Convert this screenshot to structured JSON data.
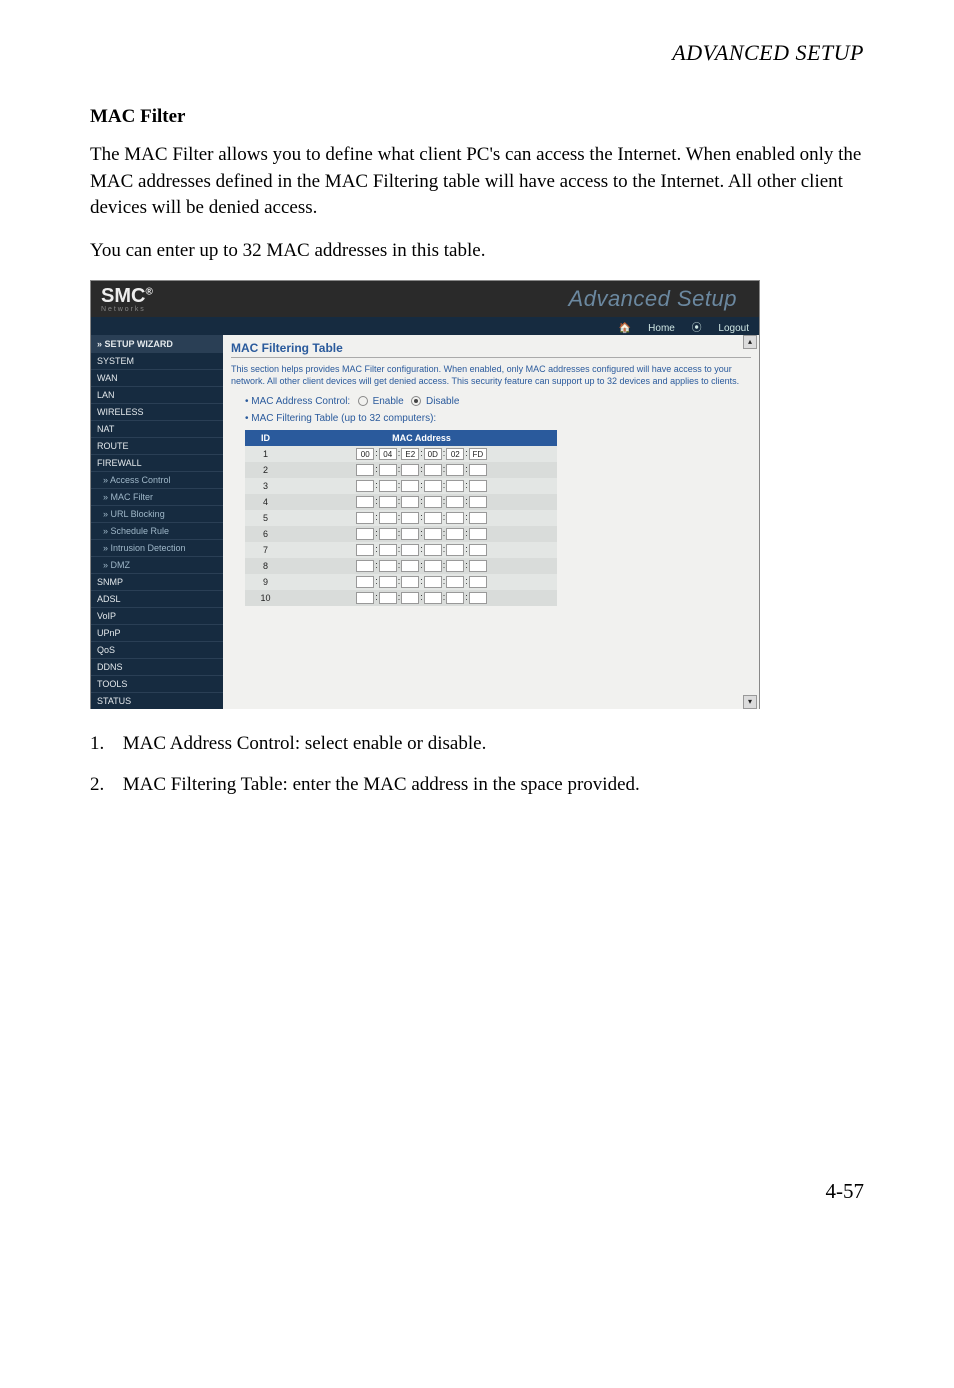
{
  "page_header": "ADVANCED SETUP",
  "h3": "MAC Filter",
  "para1": "The MAC Filter allows you to define what client PC's can access the Internet. When enabled only the MAC addresses defined in the MAC Filtering table will have access to the Internet. All other client devices will be denied access.",
  "para2": "You can enter up to 32 MAC addresses in this table.",
  "list": {
    "item1": {
      "num": "1.",
      "text": "MAC Address Control: select enable or disable."
    },
    "item2": {
      "num": "2.",
      "text": "MAC Filtering Table: enter the MAC address in the space provided."
    }
  },
  "page_number": "4-57",
  "shot": {
    "brand": "SMC",
    "brand_sub": "N e t w o r k s",
    "brand_reg": "®",
    "banner": "Advanced Setup",
    "topbar_home": "Home",
    "topbar_logout": "Logout",
    "sidebar": {
      "setup": "» SETUP WIZARD",
      "system": "SYSTEM",
      "wan": "WAN",
      "lan": "LAN",
      "wireless": "WIRELESS",
      "nat": "NAT",
      "route": "ROUTE",
      "firewall": "FIREWALL",
      "access_control": "» Access Control",
      "mac_filter": "» MAC Filter",
      "url_blocking": "» URL Blocking",
      "schedule_rule": "» Schedule Rule",
      "intrusion": "» Intrusion Detection",
      "dmz": "» DMZ",
      "snmp": "SNMP",
      "adsl": "ADSL",
      "voip": "VoIP",
      "upnp": "UPnP",
      "qos": "QoS",
      "ddns": "DDNS",
      "tools": "TOOLS",
      "status": "STATUS"
    },
    "panel": {
      "title": "MAC Filtering Table",
      "desc": "This section helps provides MAC Filter configuration. When enabled, only MAC addresses configured will have access to your network. All other client devices will get denied access. This security feature can support up to 32 devices and applies to clients.",
      "addr_control_label": "MAC Address Control:",
      "enable": "Enable",
      "disable": "Disable",
      "table_caption": "MAC Filtering Table (up to 32 computers):",
      "col_id": "ID",
      "col_mac": "MAC Address",
      "rows": [
        {
          "id": "1",
          "mac": [
            "00",
            "04",
            "E2",
            "0D",
            "02",
            "FD"
          ]
        },
        {
          "id": "2",
          "mac": [
            "",
            "",
            "",
            "",
            "",
            ""
          ]
        },
        {
          "id": "3",
          "mac": [
            "",
            "",
            "",
            "",
            "",
            ""
          ]
        },
        {
          "id": "4",
          "mac": [
            "",
            "",
            "",
            "",
            "",
            ""
          ]
        },
        {
          "id": "5",
          "mac": [
            "",
            "",
            "",
            "",
            "",
            ""
          ]
        },
        {
          "id": "6",
          "mac": [
            "",
            "",
            "",
            "",
            "",
            ""
          ]
        },
        {
          "id": "7",
          "mac": [
            "",
            "",
            "",
            "",
            "",
            ""
          ]
        },
        {
          "id": "8",
          "mac": [
            "",
            "",
            "",
            "",
            "",
            ""
          ]
        },
        {
          "id": "9",
          "mac": [
            "",
            "",
            "",
            "",
            "",
            ""
          ]
        },
        {
          "id": "10",
          "mac": [
            "",
            "",
            "",
            "",
            "",
            ""
          ]
        }
      ]
    }
  }
}
